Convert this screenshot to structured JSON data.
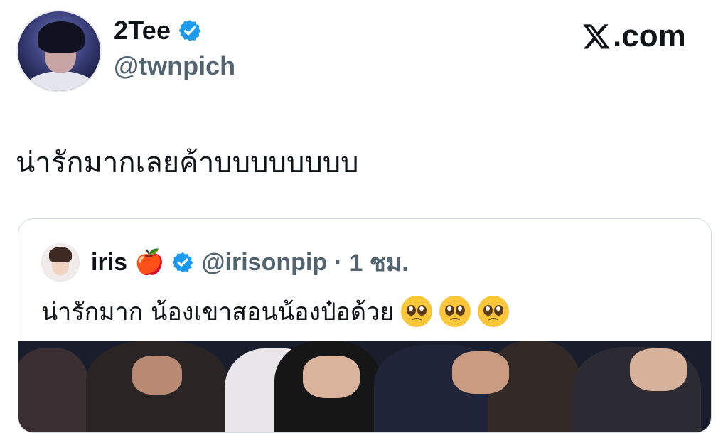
{
  "author": {
    "name": "2Tee",
    "handle": "@twnpich",
    "verified": true,
    "avatar_icon": "profile-photo"
  },
  "site": {
    "label": ".com",
    "logo": "x-logo-icon"
  },
  "tweet": {
    "text": "น่ารักมากเลยค้าบบบบบบบบ"
  },
  "quoted": {
    "name": "iris",
    "name_emoji": "🍎",
    "handle": "@irisonpip",
    "separator": "·",
    "time": "1 ชม.",
    "text": "น่ารักมาก น้องเขาสอนน้องป๋อด้วย",
    "emojis": [
      "pleading-face",
      "pleading-face",
      "pleading-face"
    ],
    "media": "photo"
  },
  "colors": {
    "verified": "#1d9bf0",
    "muted": "#536471",
    "border": "#cfd9de"
  }
}
